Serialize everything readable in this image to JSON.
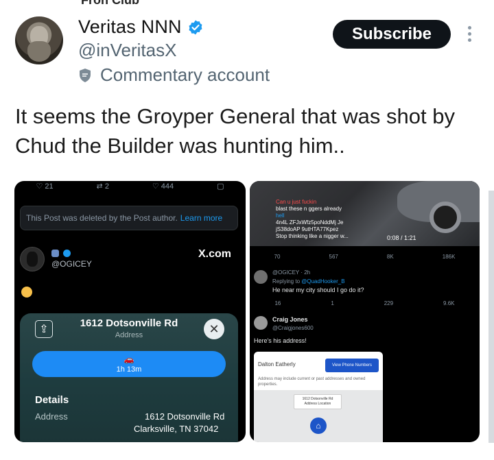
{
  "top_cut": "Fron Club",
  "author": {
    "display_name": "Veritas NNN",
    "handle": "@inVeritasX",
    "account_label": "Commentary account"
  },
  "actions": {
    "subscribe_label": "Subscribe"
  },
  "post": {
    "text": "It seems the Groyper General that was shot by Chud the Builder was hunting him.."
  },
  "left_media": {
    "action_counts": [
      "21",
      "2",
      "444"
    ],
    "deleted_notice": "This Post was deleted by the Post author.",
    "learn_more": "Learn more",
    "quoted_handle": "@OGICEY",
    "xcom_label": "X.com",
    "map": {
      "address_title": "1612 Dotsonville Rd",
      "address_sub": "Address",
      "route_time": "1h 13m",
      "details_title": "Details",
      "details_label": "Address",
      "address_line1": "1612 Dotsonville Rd",
      "address_line2": "Clarksville, TN  37042"
    }
  },
  "right_media": {
    "caption_red": "Can u just fuckin",
    "caption_line2": "blast these n ggers already",
    "caption_link": "hell",
    "caption_line4": "4n4L ZFJxWfz5poNddMj Je",
    "caption_line5": "jS38doAP 9utHTA77Kpez",
    "caption_line6": "Stop thinking like a nigger w...",
    "video_time": "0:08 / 1:21",
    "row1_counts": [
      "70",
      "567",
      "8K",
      "186K"
    ],
    "reply_handle": "@OGICEY · 2h",
    "replying_to": "Replying to",
    "replying_link": "@QuadHooker_B",
    "reply_text": "He near my city should I go do it?",
    "row2_counts": [
      "16",
      "1",
      "229",
      "9.6K"
    ],
    "craig_name": "Craig Jones",
    "craig_handle": "@Craigjones600",
    "craig_text": "Here's his address!",
    "card": {
      "name": "Dalton Eatherly",
      "view_button": "View Phone Numbers",
      "note": "Address may include current or past addresses and owned properties.",
      "tip_title": "1612 Dotsonville Rd",
      "tip_sub": "Address Location"
    }
  }
}
